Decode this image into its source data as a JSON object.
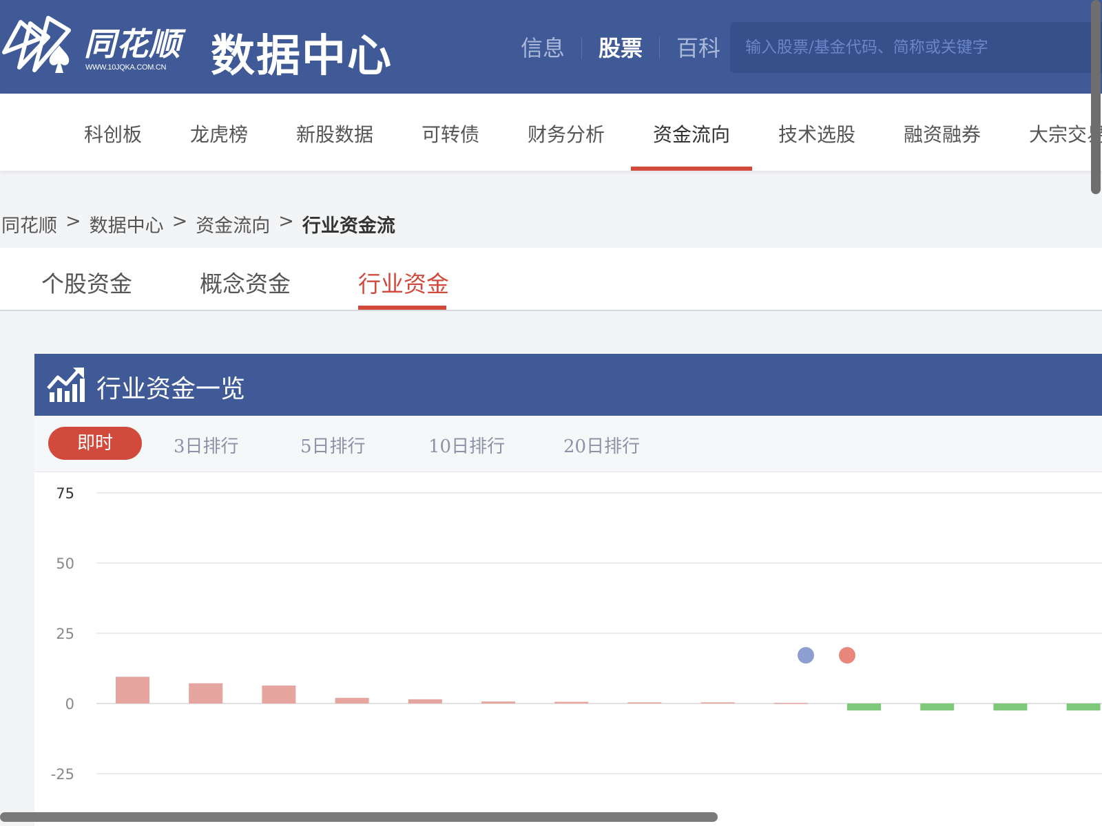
{
  "header": {
    "brand_name": "同花顺",
    "brand_url": "WWW.10JQKA.COM.CN",
    "site_title": "数据中心",
    "nav": [
      {
        "label": "信息",
        "active": false
      },
      {
        "label": "股票",
        "active": true
      },
      {
        "label": "百科",
        "active": false
      }
    ],
    "search_placeholder": "输入股票/基金代码、简称或关键字"
  },
  "main_nav": {
    "items": [
      "科创板",
      "龙虎榜",
      "新股数据",
      "可转债",
      "财务分析",
      "资金流向",
      "技术选股",
      "融资融券",
      "大宗交易"
    ],
    "active": "资金流向"
  },
  "breadcrumb": {
    "items": [
      "同花顺",
      "数据中心",
      "资金流向",
      "行业资金流"
    ],
    "separator": ">"
  },
  "sub_tabs": {
    "items": [
      "个股资金",
      "概念资金",
      "行业资金"
    ],
    "active": "行业资金"
  },
  "panel": {
    "title": "行业资金一览",
    "ranges": [
      "即时",
      "3日排行",
      "5日排行",
      "10日排行",
      "20日排行"
    ],
    "active_range": "即时"
  },
  "colors": {
    "primary": "#3f5a97",
    "accent": "#d24a3c",
    "bar_positive": "#e6a59f",
    "bar_negative": "#7fc97a",
    "legend_blue": "#8d9fd0",
    "legend_red": "#e8867e"
  },
  "chart_data": {
    "type": "bar",
    "y_ticks": [
      75,
      50,
      25,
      0,
      -25
    ],
    "ylim": [
      -25,
      75
    ],
    "grid": true,
    "values": [
      9.5,
      7.2,
      6.4,
      2.0,
      1.5,
      0.7,
      0.6,
      0.4,
      0.4,
      0.2,
      -2.5,
      -2.5,
      -2.5,
      -2.5
    ],
    "legend_markers": 2
  }
}
